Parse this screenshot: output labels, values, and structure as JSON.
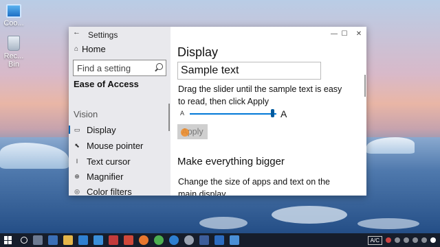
{
  "desktop": {
    "icons": [
      {
        "label": "Coo...",
        "icon": "this-pc-icon"
      },
      {
        "label": "Rec... Bin",
        "icon": "recycle-bin-icon"
      }
    ]
  },
  "window": {
    "title": "Settings",
    "back_glyph": "←",
    "controls": {
      "minimize": "—",
      "maximize": "☐",
      "close": "✕"
    }
  },
  "sidebar": {
    "home_label": "Home",
    "search_placeholder": "Find a setting",
    "section_title": "Ease of Access",
    "group_label": "Vision",
    "items": [
      {
        "label": "Display",
        "icon": "display-icon",
        "glyph": "▭",
        "active": true
      },
      {
        "label": "Mouse pointer",
        "icon": "mouse-pointer-icon",
        "glyph": "⬉"
      },
      {
        "label": "Text cursor",
        "icon": "text-cursor-icon",
        "glyph": "I"
      },
      {
        "label": "Magnifier",
        "icon": "magnifier-icon",
        "glyph": "⊕"
      },
      {
        "label": "Color filters",
        "icon": "color-filters-icon",
        "glyph": "◎"
      }
    ]
  },
  "main": {
    "heading": "Display",
    "sample_text": "Sample text",
    "instruction": "Drag the slider until the sample text is easy to read, then click Apply",
    "slider": {
      "min_label": "A",
      "max_label": "A",
      "value_fraction": 0.95
    },
    "apply_label": "Apply",
    "section2_heading": "Make everything bigger",
    "section2_desc": "Change the size of apps and text on the main display"
  },
  "taskbar": {
    "tray": {
      "language": "A/C"
    },
    "app_icons": [
      "search-icon",
      "task-view-icon",
      "store-icon",
      "explorer-icon",
      "mail-icon",
      "browser-icon",
      "media-icon",
      "firefox-icon",
      "chrome-icon",
      "edge-icon",
      "settings-icon",
      "app-icon",
      "app-icon",
      "app-icon",
      "app-icon"
    ]
  },
  "colors": {
    "accent": "#0078d7",
    "sidebar_bg": "#e8e8ec",
    "taskbar_bg": "#161c28"
  }
}
